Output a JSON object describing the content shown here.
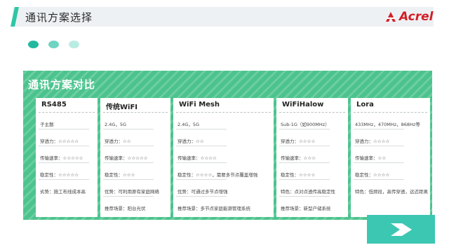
{
  "header": {
    "title": "通讯方案选择"
  },
  "logo": {
    "text": "Acrel",
    "color": "#d21f26"
  },
  "panel": {
    "title": "通讯方案对比",
    "color": "#4cc38d"
  },
  "columns": [
    {
      "name": "RS485",
      "cells": [
        "子主题",
        "穿透力：☆☆☆☆☆",
        "传输速率：☆☆☆☆☆",
        "稳定性：☆☆☆☆☆",
        "劣势：施工布线成本高"
      ]
    },
    {
      "name": "传统WiFI",
      "cells": [
        "2.4G，5G",
        "穿透力：☆☆",
        "传输速率：☆☆☆☆☆",
        "稳定性：☆☆☆",
        "优势：可利用原有家庭网络",
        "推荐场景：阳台光伏"
      ]
    },
    {
      "name": "WiFi Mesh",
      "cells": [
        "2.4G，5G",
        "穿透力：☆☆",
        "传输速率：☆☆☆☆",
        "稳定性：☆☆☆☆，需要多节点覆盖增强",
        "优势：可通过多节点增强",
        "推荐场景：多节点家庭能源管理系统"
      ]
    },
    {
      "name": "WiFiHalow",
      "cells": [
        "Sub-1G（如900MHz）",
        "穿透力：☆☆☆☆",
        "传输速率：☆☆☆",
        "稳定性：☆☆☆☆",
        "特色：点对点透传高稳定性",
        "推荐场景：新型户储系统"
      ]
    },
    {
      "name": "Lora",
      "cells": [
        "433MHz，470MHz，868Hz等",
        "穿透力：☆☆☆☆",
        "传输速率：☆☆",
        "稳定性：☆☆☆☆",
        "特色：低频段，高传穿透，远近距离"
      ]
    }
  ],
  "next_button": {
    "icon": "chevron-right-icon",
    "color": "#3cc7b3"
  }
}
